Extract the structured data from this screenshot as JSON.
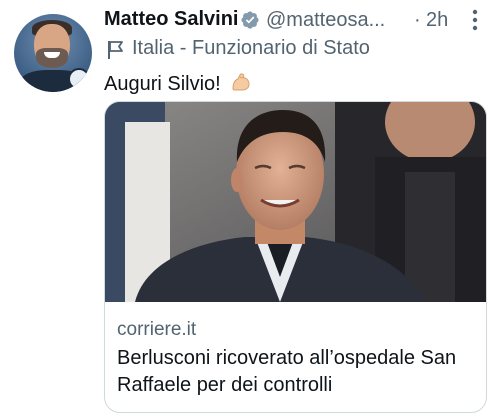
{
  "author": {
    "name": "Matteo Salvini",
    "handle": "@matteosa...",
    "separator": "·",
    "time": "2h",
    "label": "Italia - Funzionario di Stato"
  },
  "tweet": {
    "text": "Auguri Silvio!"
  },
  "card": {
    "domain": "corriere.it",
    "title": "Berlusconi ricoverato all’ospedale San Raffaele per dei controlli"
  },
  "icons": {
    "verified": "verified-badge-icon",
    "more": "more-options-icon",
    "flag": "government-flag-icon",
    "emoji": "flexed-biceps-emoji"
  },
  "colors": {
    "text": "#0f1419",
    "secondary": "#536471",
    "verified": "#829aab",
    "border": "#cfd9de"
  }
}
